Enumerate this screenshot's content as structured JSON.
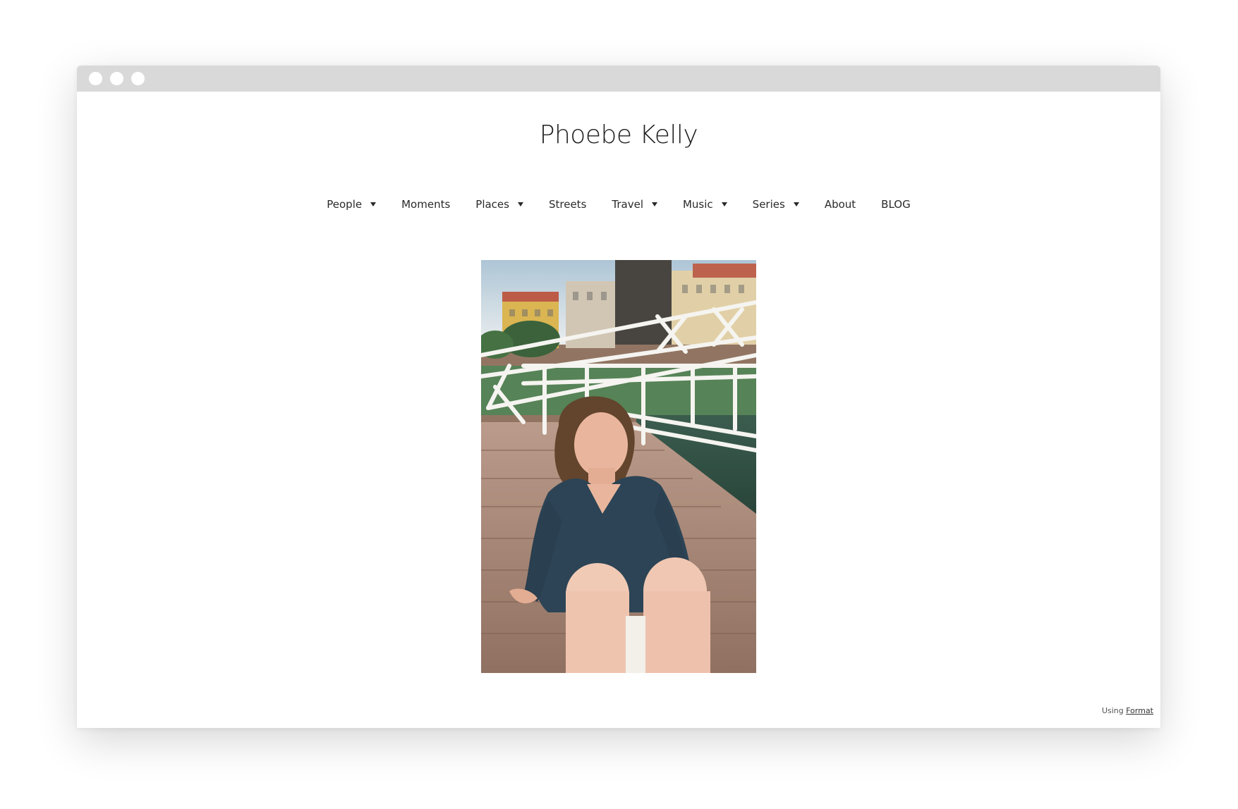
{
  "site": {
    "title": "Phoebe Kelly"
  },
  "nav": {
    "items": [
      {
        "label": "People",
        "has_dropdown": true
      },
      {
        "label": "Moments",
        "has_dropdown": false
      },
      {
        "label": "Places",
        "has_dropdown": true
      },
      {
        "label": "Streets",
        "has_dropdown": false
      },
      {
        "label": "Travel",
        "has_dropdown": true
      },
      {
        "label": "Music",
        "has_dropdown": true
      },
      {
        "label": "Series",
        "has_dropdown": true
      },
      {
        "label": "About",
        "has_dropdown": false
      },
      {
        "label": "BLOG",
        "has_dropdown": false
      }
    ]
  },
  "footer": {
    "prefix": "Using",
    "link_label": "Format"
  },
  "colors": {
    "titlebar": "#d9d9d9",
    "text": "#2a2a2a",
    "background": "#ffffff"
  }
}
